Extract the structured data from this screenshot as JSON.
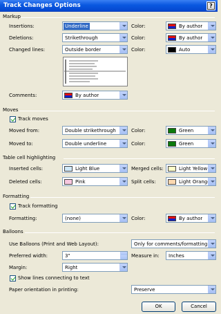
{
  "title": "Track Changes Options",
  "help_label": "?",
  "markup": {
    "header": "Markup",
    "insertions_label": "Insertions:",
    "insertions_value": "Underline",
    "insertions_color_label": "Color:",
    "insertions_color_value": "By author",
    "deletions_label": "Deletions:",
    "deletions_value": "Strikethrough",
    "deletions_color_label": "Color:",
    "deletions_color_value": "By author",
    "changed_lines_label": "Changed lines:",
    "changed_lines_value": "Outside border",
    "changed_lines_color_label": "Color:",
    "changed_lines_color_value": "Auto",
    "comments_label": "Comments:",
    "comments_value": "By author"
  },
  "moves": {
    "header": "Moves",
    "track_moves_label": "Track moves",
    "moved_from_label": "Moved from:",
    "moved_from_value": "Double strikethrough",
    "moved_from_color_label": "Color:",
    "moved_from_color_value": "Green",
    "moved_to_label": "Moved to:",
    "moved_to_value": "Double underline",
    "moved_to_color_label": "Color:",
    "moved_to_color_value": "Green"
  },
  "table_cells": {
    "header": "Table cell highlighting",
    "inserted_label": "Inserted cells:",
    "inserted_value": "Light Blue",
    "merged_label": "Merged cells:",
    "merged_value": "Light Yellow",
    "deleted_label": "Deleted cells:",
    "deleted_value": "Pink",
    "split_label": "Split cells:",
    "split_value": "Light Orange"
  },
  "formatting": {
    "header": "Formatting",
    "track_formatting_label": "Track formatting",
    "formatting_label": "Formatting:",
    "formatting_value": "(none)",
    "color_label": "Color:",
    "color_value": "By author"
  },
  "balloons": {
    "header": "Balloons",
    "use_balloons_label": "Use Balloons (Print and Web Layout):",
    "use_balloons_value": "Only for comments/formatting",
    "preferred_width_label": "Preferred width:",
    "preferred_width_value": "3\"",
    "measure_in_label": "Measure in:",
    "measure_in_value": "Inches",
    "margin_label": "Margin:",
    "margin_value": "Right",
    "show_lines_label": "Show lines connecting to text",
    "paper_orientation_label": "Paper orientation in printing:",
    "paper_orientation_value": "Preserve"
  },
  "buttons": {
    "ok": "OK",
    "cancel": "Cancel"
  },
  "colors": {
    "by_author_top": "#E01010",
    "by_author_bottom": "#1020C8",
    "auto": "#000000",
    "green": "#0B7A0B",
    "light_blue": "#CFE8F8",
    "light_yellow": "#FFFFC8",
    "pink": "#F8C8E0",
    "light_orange": "#FBD8B0"
  }
}
